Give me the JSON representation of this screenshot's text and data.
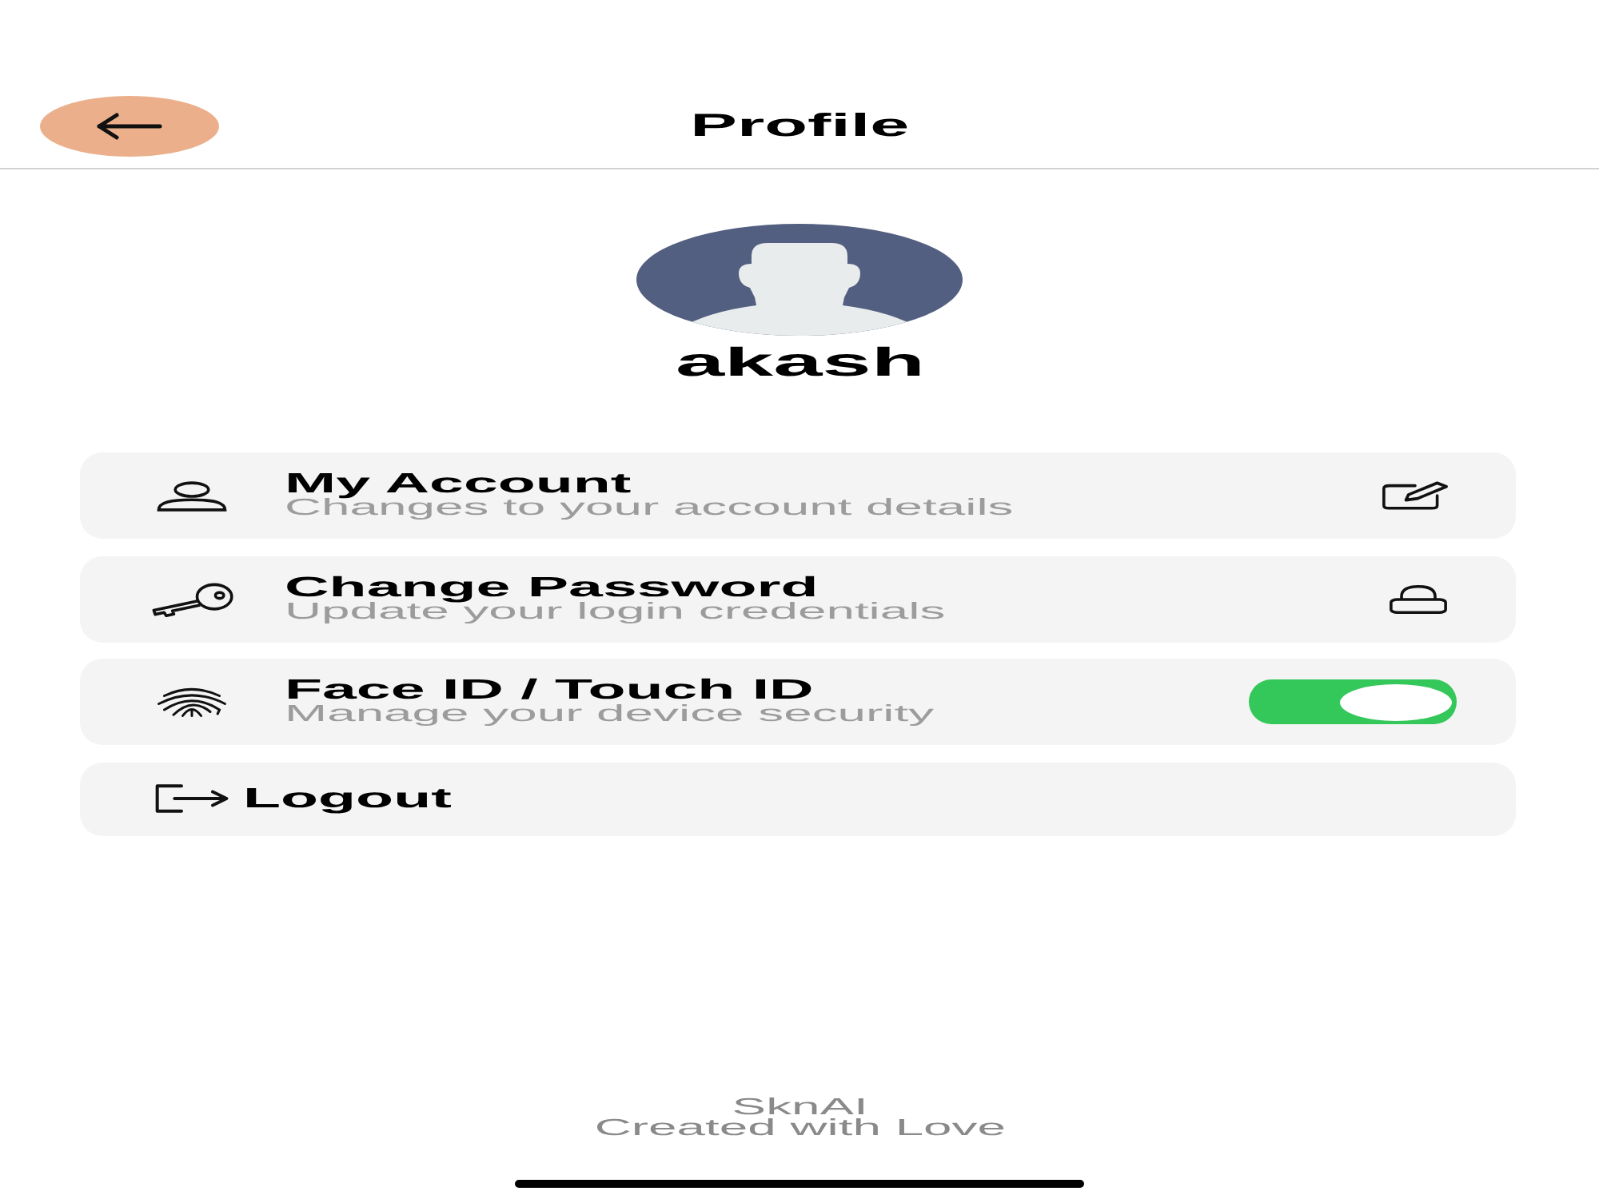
{
  "header": {
    "title": "Profile"
  },
  "profile": {
    "name": "akash"
  },
  "menu": [
    {
      "kind": "link",
      "title": "My Account",
      "subtitle": "Changes to your account details"
    },
    {
      "kind": "link",
      "title": "Change Password",
      "subtitle": "Update your login credentials"
    },
    {
      "kind": "toggle",
      "title": "Face ID / Touch ID",
      "subtitle": "Manage your device security",
      "on": true
    },
    {
      "kind": "action",
      "title": "Logout"
    }
  ],
  "footer": {
    "brand": "SknAI",
    "tagline": "Created with Love"
  }
}
